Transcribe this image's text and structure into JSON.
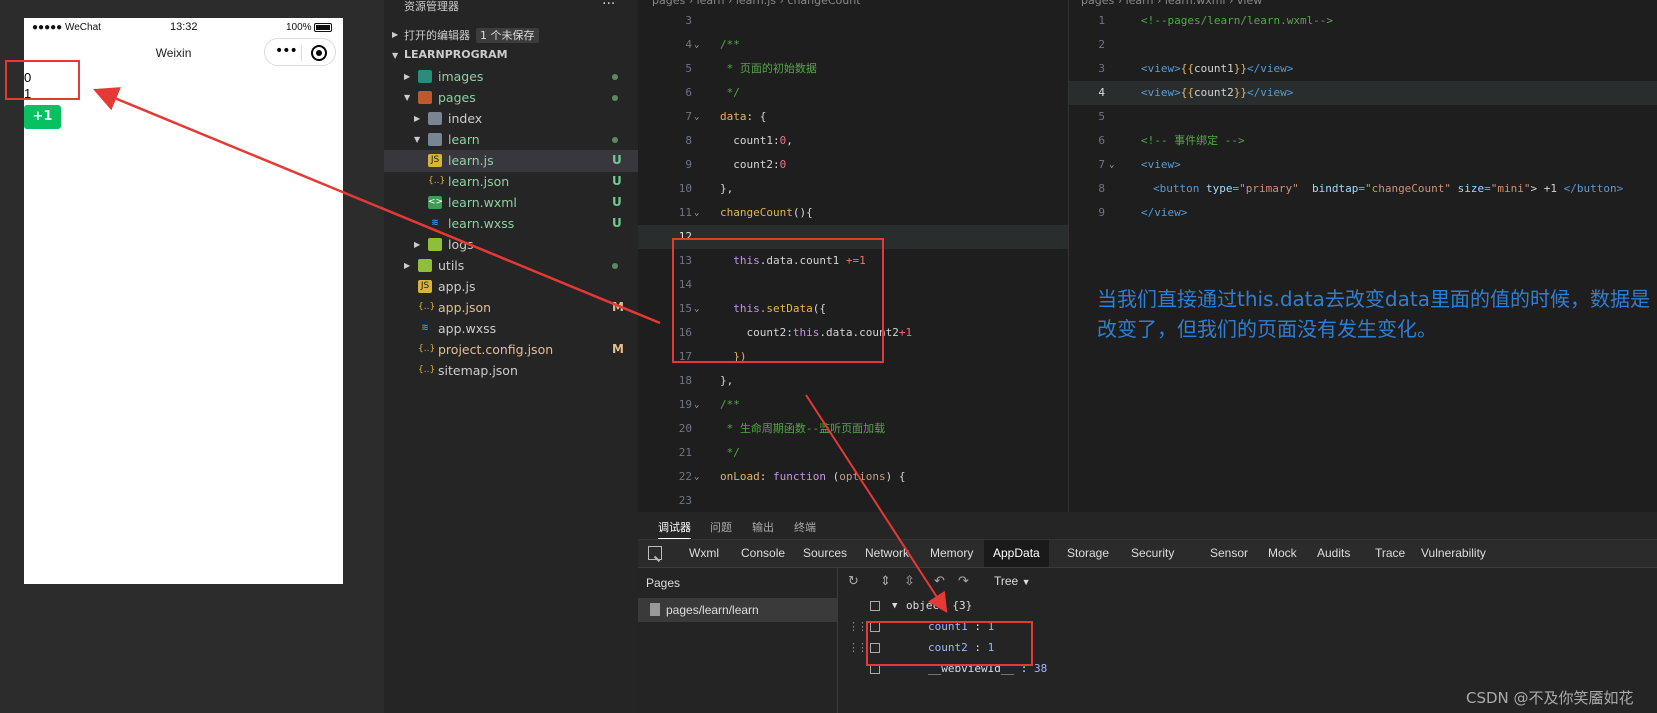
{
  "simulator": {
    "signal": "●●●●● WeChat",
    "time": "13:32",
    "battery": "100%",
    "title": "Weixin",
    "capsule_dots": "•••",
    "count1": "0",
    "count2": "1",
    "button_label": "+1"
  },
  "explorer": {
    "header": "资源管理器",
    "more": "...",
    "open_editors": "打开的编辑器",
    "unsaved": "1 个未保存",
    "project": "LEARNPROGRAM",
    "items": [
      {
        "label": "images",
        "badge": "",
        "dot": true
      },
      {
        "label": "pages",
        "badge": "",
        "dot": true
      },
      {
        "label": "index",
        "badge": "",
        "dot": false
      },
      {
        "label": "learn",
        "badge": "",
        "dot": true
      },
      {
        "label": "learn.js",
        "badge": "U",
        "dot": false
      },
      {
        "label": "learn.json",
        "badge": "U",
        "dot": false
      },
      {
        "label": "learn.wxml",
        "badge": "U",
        "dot": false
      },
      {
        "label": "learn.wxss",
        "badge": "U",
        "dot": false
      },
      {
        "label": "logs",
        "badge": "",
        "dot": false
      },
      {
        "label": "utils",
        "badge": "",
        "dot": true
      },
      {
        "label": "app.js",
        "badge": "",
        "dot": false
      },
      {
        "label": "app.json",
        "badge": "M",
        "dot": false
      },
      {
        "label": "app.wxss",
        "badge": "",
        "dot": false
      },
      {
        "label": "project.config.json",
        "badge": "M",
        "dot": false
      },
      {
        "label": "sitemap.json",
        "badge": "",
        "dot": false
      }
    ]
  },
  "editor": {
    "breadcrumb": "pages › learn › learn.js › changeCount",
    "line_numbers": [
      "3",
      "4",
      "5",
      "6",
      "7",
      "8",
      "9",
      "10",
      "11",
      "12",
      "13",
      "14",
      "15",
      "16",
      "17",
      "18",
      "19",
      "20",
      "21",
      "22",
      "23"
    ],
    "current_line": "12",
    "code": {
      "l4": "/**",
      "l5": " * 页面的初始数据",
      "l6": " */",
      "l7_key": "data",
      "l7_rest": ": {",
      "l8_key": "  count1",
      "l8_rest": ":",
      "l8_num": "0",
      "l8_end": ",",
      "l9_key": "  count2",
      "l9_rest": ":",
      "l9_num": "0",
      "l10": "},",
      "l11_fn": "changeCount",
      "l11_rest": "(){",
      "l13_this": "  this",
      "l13_rest": ".data.count1 ",
      "l13_op": "+=",
      "l13_num": "1",
      "l15_this": "  this",
      "l15_fn": ".setData",
      "l15_rest": "({",
      "l16_key": "    count2",
      "l16_rest": ":",
      "l16_this": "this",
      "l16_rest2": ".data.count2",
      "l16_op": "+",
      "l16_num": "1",
      "l17": "  })",
      "l18": "},",
      "l19": "/**",
      "l20": " * 生命周期函数--监听页面加载",
      "l21": " */",
      "l22_key": "onLoad",
      "l22_rest": ": ",
      "l22_fn": "function",
      "l22_rest2": " (",
      "l22_param": "options",
      "l22_end": ") {"
    }
  },
  "wxml": {
    "breadcrumb": "pages › learn › learn.wxml › view",
    "line_numbers": [
      "1",
      "2",
      "3",
      "4",
      "5",
      "6",
      "7",
      "8",
      "9"
    ],
    "current_line": "4",
    "l1": "<!--pages/learn/learn.wxml-->",
    "l3_open": "<view>",
    "l3_br1": "{{",
    "l3_var": "count1",
    "l3_br2": "}}",
    "l3_close": "</view>",
    "l4_open": "<view>",
    "l4_br1": "{{",
    "l4_var": "count2",
    "l4_br2": "}}",
    "l4_close": "</view>",
    "l6": "<!-- 事件绑定 -->",
    "l7": "<view>",
    "l8_tag": "<button",
    "l8_a1": " type",
    "l8_v1": "=\"primary\"",
    "l8_a2": "  bindtap",
    "l8_v2": "=\"changeCount\"",
    "l8_a3": " size",
    "l8_v3": "=\"mini\"",
    "l8_mid": "> +1 ",
    "l8_end": "</button>",
    "l9": "</view>"
  },
  "devtools": {
    "top_tabs": [
      "调试器",
      "问题",
      "输出",
      "终端"
    ],
    "panel_tabs": [
      "Wxml",
      "Console",
      "Sources",
      "Network",
      "Memory",
      "AppData",
      "Storage",
      "Security",
      "Sensor",
      "Mock",
      "Audits",
      "Trace",
      "Vulnerability"
    ],
    "active_panel": "AppData",
    "pages_title": "Pages",
    "page_item": "pages/learn/learn",
    "view_mode": "Tree",
    "tree": {
      "root": "object {3}",
      "rows": [
        {
          "key": "count1",
          "value": "1"
        },
        {
          "key": "count2",
          "value": "1"
        },
        {
          "key": "__webviewId__",
          "value": "38"
        }
      ]
    }
  },
  "annotation": "当我们直接通过this.data去改变data里面的值的时候，数据是改变了，但我们的页面没有发生变化。",
  "watermark": "CSDN @不及你笑靥如花",
  "colors": {
    "annotation_red": "#e53935",
    "annotation_blue": "#2e7fd3",
    "wechat_green": "#07c160"
  }
}
